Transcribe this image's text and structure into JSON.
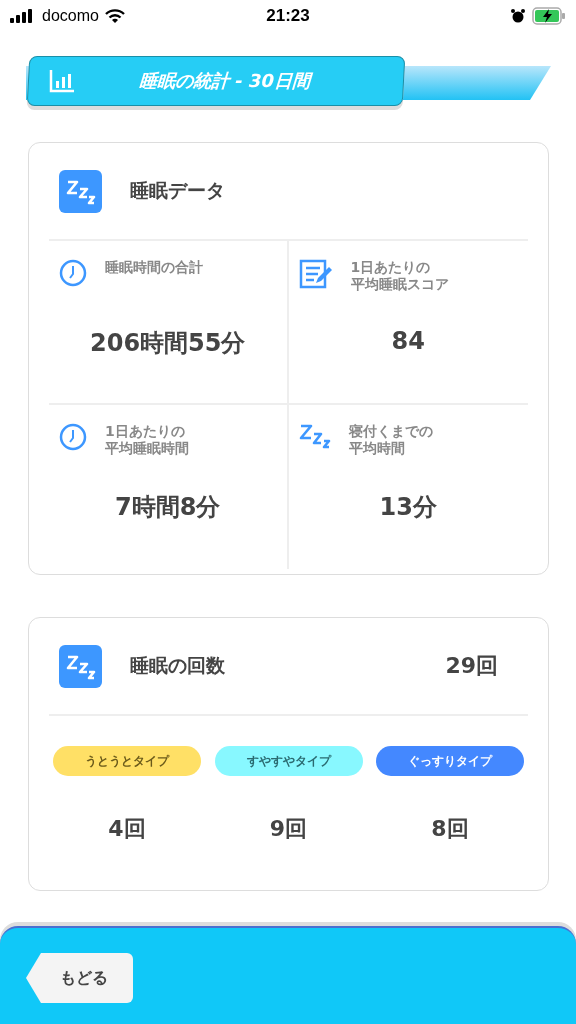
{
  "status_bar": {
    "carrier": "docomo",
    "time": "21:23",
    "battery_charging": true
  },
  "header": {
    "title": "睡眠の統計 - 30日間"
  },
  "sleep_data": {
    "title": "睡眠データ",
    "stats": [
      {
        "kind": "clock",
        "label": [
          "睡眠時間の合計"
        ],
        "value": "206時間55分"
      },
      {
        "kind": "memo",
        "label": [
          "1日あたりの",
          "平均睡眠スコア"
        ],
        "value": "84"
      },
      {
        "kind": "clock",
        "label": [
          "1日あたりの",
          "平均睡眠時間"
        ],
        "value": "7時間8分"
      },
      {
        "kind": "zzz",
        "label": [
          "寝付くまでの",
          "平均時間"
        ],
        "value": "13分"
      }
    ]
  },
  "sleep_count": {
    "title": "睡眠の回数",
    "total": "29回",
    "types": [
      {
        "label": "うとうとタイプ",
        "color": "#ffe066",
        "count": "4回"
      },
      {
        "label": "すやすやタイプ",
        "color": "#88f8ff",
        "count": "9回"
      },
      {
        "label": "ぐっすりタイプ",
        "color": "#4488ff",
        "count": "8回"
      }
    ]
  },
  "footer": {
    "back_button": "もどる"
  }
}
